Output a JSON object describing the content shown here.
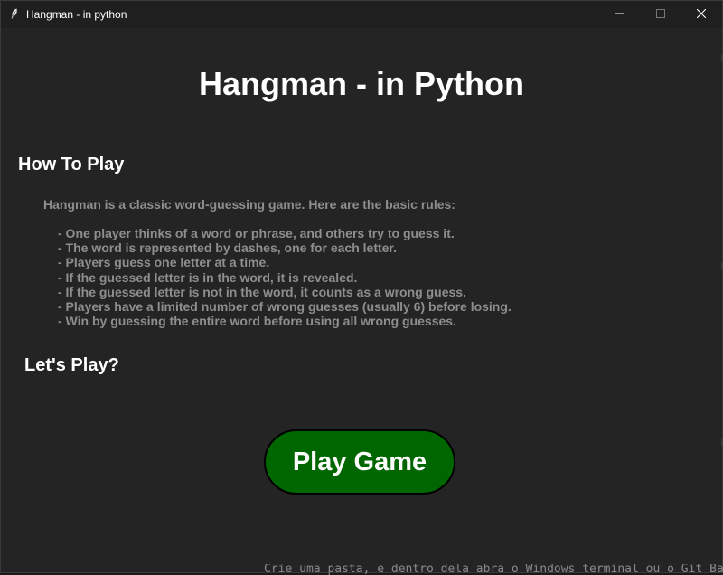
{
  "window": {
    "title": "Hangman - in python",
    "app_icon": "feather-icon",
    "controls": {
      "minimize_icon": "minimize-icon",
      "maximize_icon": "maximize-icon",
      "close_icon": "close-icon"
    }
  },
  "main": {
    "title": "Hangman - in Python",
    "how_to_play": {
      "heading": "How To Play",
      "intro": "Hangman is a classic word-guessing game. Here are the basic rules:",
      "rules": [
        "- One player thinks of a word or phrase, and others try to guess it.",
        "- The word is represented by dashes, one for each letter.",
        "- Players guess one letter at a time.",
        "- If the guessed letter is in the word, it is revealed.",
        "- If the guessed letter is not in the word, it counts as a wrong guess.",
        "- Players have a limited number of wrong guesses (usually 6) before losing.",
        "- Win by guessing the entire word before using all wrong guesses."
      ]
    },
    "lets_play_heading": "Let's Play?",
    "play_button_label": "Play Game"
  },
  "background": {
    "partial_text": "Crie uma pasta, e dentro dela abra o Windows terminal ou o Git Bash"
  },
  "colors": {
    "window_bg": "#242424",
    "titlebar_bg": "#1f1f1f",
    "text_primary": "#ffffff",
    "text_muted": "#8e8e8e",
    "play_button_bg": "#006600",
    "play_button_border": "#000000"
  }
}
